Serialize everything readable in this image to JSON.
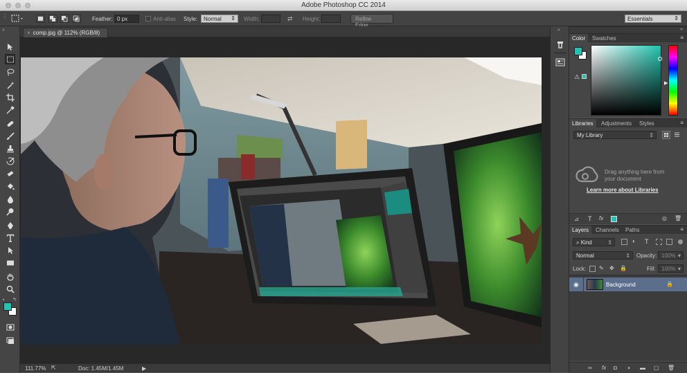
{
  "window": {
    "title": "Adobe Photoshop CC 2014"
  },
  "options_bar": {
    "feather_label": "Feather:",
    "feather_value": "0 px",
    "anti_alias_label": "Anti-alias",
    "style_label": "Style:",
    "style_value": "Normal",
    "width_label": "Width:",
    "height_label": "Height:",
    "refine_edge_label": "Refine Edge...",
    "workspace_value": "Essentials"
  },
  "document": {
    "tab_label": "comp.jpg @ 112% (RGB/8)",
    "zoom": "111.77%",
    "doc_info": "Doc: 1.45M/1.45M"
  },
  "color_panel": {
    "tabs": [
      "Color",
      "Swatches"
    ],
    "foreground": "#20c4b0",
    "background": "#ffffff"
  },
  "libraries_panel": {
    "tabs": [
      "Libraries",
      "Adjustments",
      "Styles"
    ],
    "library_name": "My Library",
    "empty_text_line1": "Drag anything here from",
    "empty_text_line2": "your document",
    "learn_more": "Learn more about Libraries"
  },
  "layers_panel": {
    "tabs": [
      "Layers",
      "Channels",
      "Paths"
    ],
    "filter_kind": "Kind",
    "blend_mode": "Normal",
    "opacity_label": "Opacity:",
    "opacity_value": "100%",
    "lock_label": "Lock:",
    "fill_label": "Fill:",
    "fill_value": "100%",
    "layers": [
      {
        "name": "Background",
        "visible": true,
        "locked": true,
        "selected": true
      }
    ]
  },
  "colors": {
    "accent_selected_layer": "#5b6f8c",
    "link_color": "#e8e8e8",
    "ui_dark": "#282828"
  }
}
